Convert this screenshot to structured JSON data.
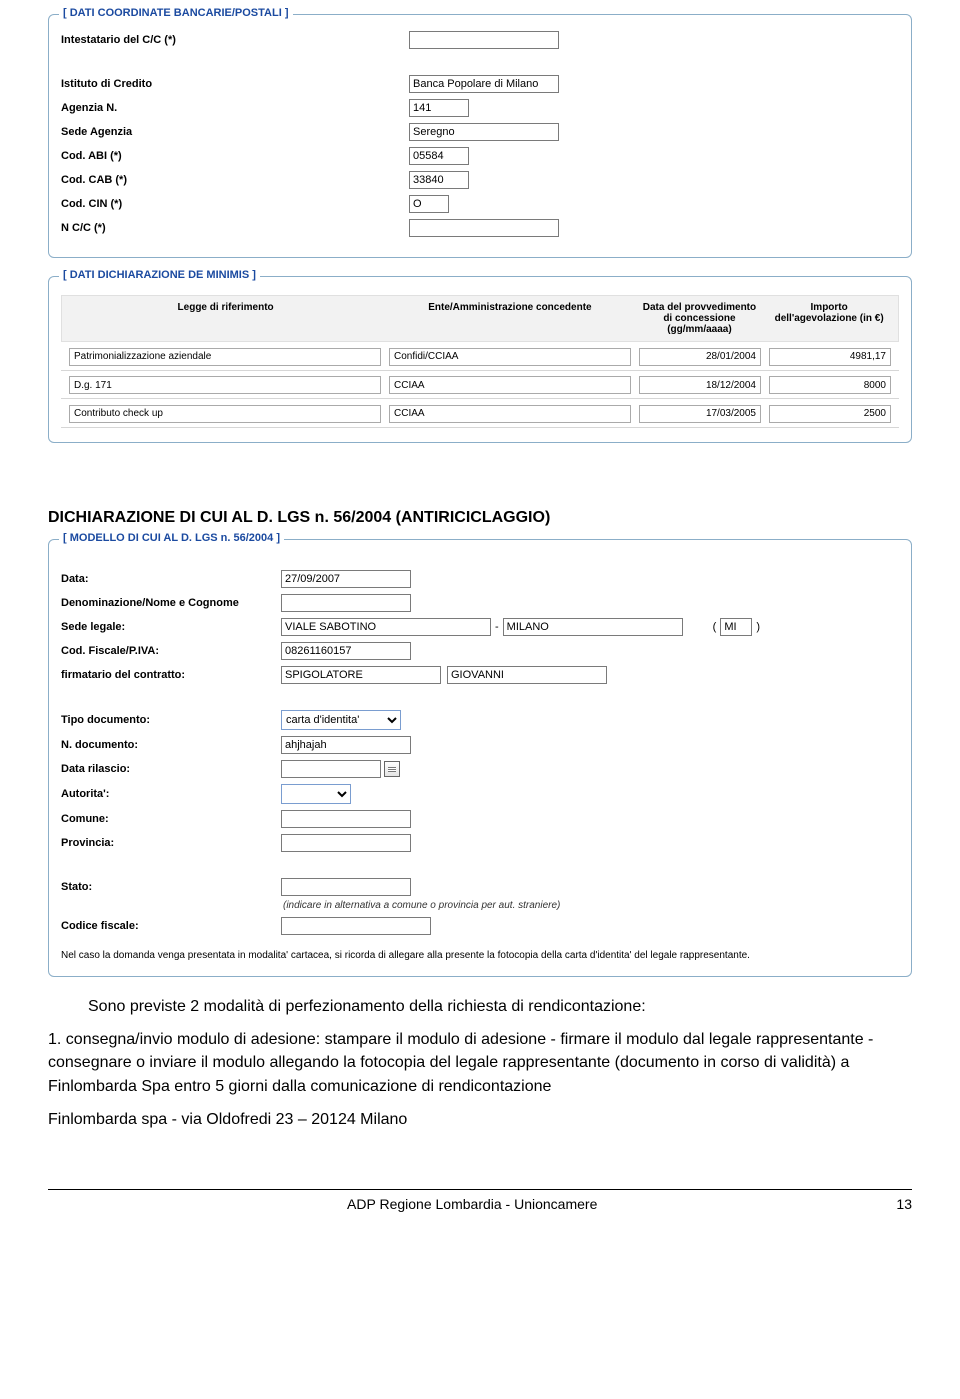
{
  "bank": {
    "legend": "[ DATI COORDINATE BANCARIE/POSTALI ]",
    "rows": {
      "intestatario": {
        "label": "Intestatario del C/C (*)",
        "value": ""
      },
      "istituto": {
        "label": "Istituto di Credito",
        "value": "Banca Popolare di Milano"
      },
      "agenzia_n": {
        "label": "Agenzia N.",
        "value": "141"
      },
      "sede_agenzia": {
        "label": "Sede Agenzia",
        "value": "Seregno"
      },
      "cod_abi": {
        "label": "Cod. ABI (*)",
        "value": "05584"
      },
      "cod_cab": {
        "label": "Cod. CAB (*)",
        "value": "33840"
      },
      "cod_cin": {
        "label": "Cod. CIN (*)",
        "value": "O"
      },
      "ncc": {
        "label": "N C/C (*)",
        "value": ""
      }
    }
  },
  "deminimis": {
    "legend": "[ DATI DICHIARAZIONE DE MINIMIS ]",
    "headers": {
      "legge": "Legge di riferimento",
      "ente": "Ente/Amministrazione concedente",
      "data": "Data del provvedimento di concessione (gg/mm/aaaa)",
      "importo": "Importo dell'agevolazione (in €)"
    },
    "rows": [
      {
        "legge": "Patrimonializzazione aziendale",
        "ente": "Confidi/CCIAA",
        "data": "28/01/2004",
        "importo": "4981,17"
      },
      {
        "legge": "D.g. 171",
        "ente": "CCIAA",
        "data": "18/12/2004",
        "importo": "8000"
      },
      {
        "legge": "Contributo check up",
        "ente": "CCIAA",
        "data": "17/03/2005",
        "importo": "2500"
      }
    ]
  },
  "heading_anti": "DICHIARAZIONE DI CUI AL D. LGS n. 56/2004 (ANTIRICICLAGGIO)",
  "modello": {
    "legend": "[ MODELLO DI CUI AL D. LGS n. 56/2004 ]",
    "rows": {
      "data": {
        "label": "Data:",
        "value": "27/09/2007"
      },
      "denominazione": {
        "label": "Denominazione/Nome e Cognome",
        "value": ""
      },
      "sede_legale_label": "Sede legale:",
      "sede_legale_via": "VIALE SABOTINO",
      "sede_legale_citta": "MILANO",
      "sede_legale_prov": "MI",
      "cf_piva": {
        "label": "Cod. Fiscale/P.IVA:",
        "value": "08261160157"
      },
      "firmatario_label": "firmatario del contratto:",
      "firmatario_cognome": "SPIGOLATORE",
      "firmatario_nome": "GIOVANNI",
      "tipo_doc": {
        "label": "Tipo documento:",
        "value": "carta d'identita'"
      },
      "n_doc": {
        "label": "N. documento:",
        "value": "ahjhajah"
      },
      "data_rilascio": {
        "label": "Data rilascio:",
        "value": ""
      },
      "autorita": {
        "label": "Autorita':",
        "value": ""
      },
      "comune": {
        "label": "Comune:",
        "value": ""
      },
      "provincia": {
        "label": "Provincia:",
        "value": ""
      },
      "stato": {
        "label": "Stato:",
        "value": ""
      },
      "stato_hint": "(indicare in alternativa a comune o provincia per aut. straniere)",
      "codice_fiscale": {
        "label": "Codice fiscale:",
        "value": ""
      }
    },
    "note": "Nel caso la domanda venga presentata in modalita' cartacea, si ricorda di allegare alla presente la fotocopia della carta d'identita' del legale rappresentante."
  },
  "body": {
    "intro": "Sono previste 2 modalità di perfezionamento della richiesta di rendicontazione:",
    "p1": "1. consegna/invio modulo di adesione: stampare il modulo di adesione - firmare il modulo dal legale rappresentante - consegnare o inviare il modulo allegando la fotocopia del legale rappresentante (documento in corso di validità) a Finlombarda Spa entro 5 giorni dalla comunicazione di rendicontazione",
    "p2": "Finlombarda spa - via Oldofredi 23 – 20124 Milano"
  },
  "footer": {
    "left": "ADP Regione Lombardia - Unioncamere",
    "right": "13"
  }
}
